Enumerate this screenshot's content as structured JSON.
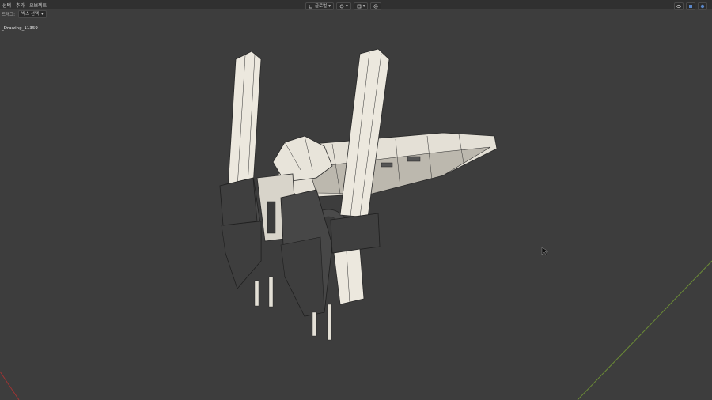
{
  "menu": {
    "items": [
      "선택",
      "추가",
      "오브젝트"
    ]
  },
  "tools": {
    "label": "드래그:",
    "select_box_label": "박스 선택"
  },
  "header_center": {
    "orientation_label": "글로벌"
  },
  "viewport": {
    "object_name": "_Drawing_11359"
  },
  "icons": [
    "pivot-icon",
    "snap-icon",
    "proportional-icon",
    "view-icon",
    "gizmo-icon",
    "overlay-icon",
    "shading-icon",
    "cursor-icon"
  ],
  "colors": {
    "background": "#3d3d3d",
    "header": "#303030",
    "mesh_light": "#e8e4da",
    "mesh_dark": "#4a4a4a",
    "axis_red": "#a03434",
    "axis_green": "#6a8a36"
  }
}
